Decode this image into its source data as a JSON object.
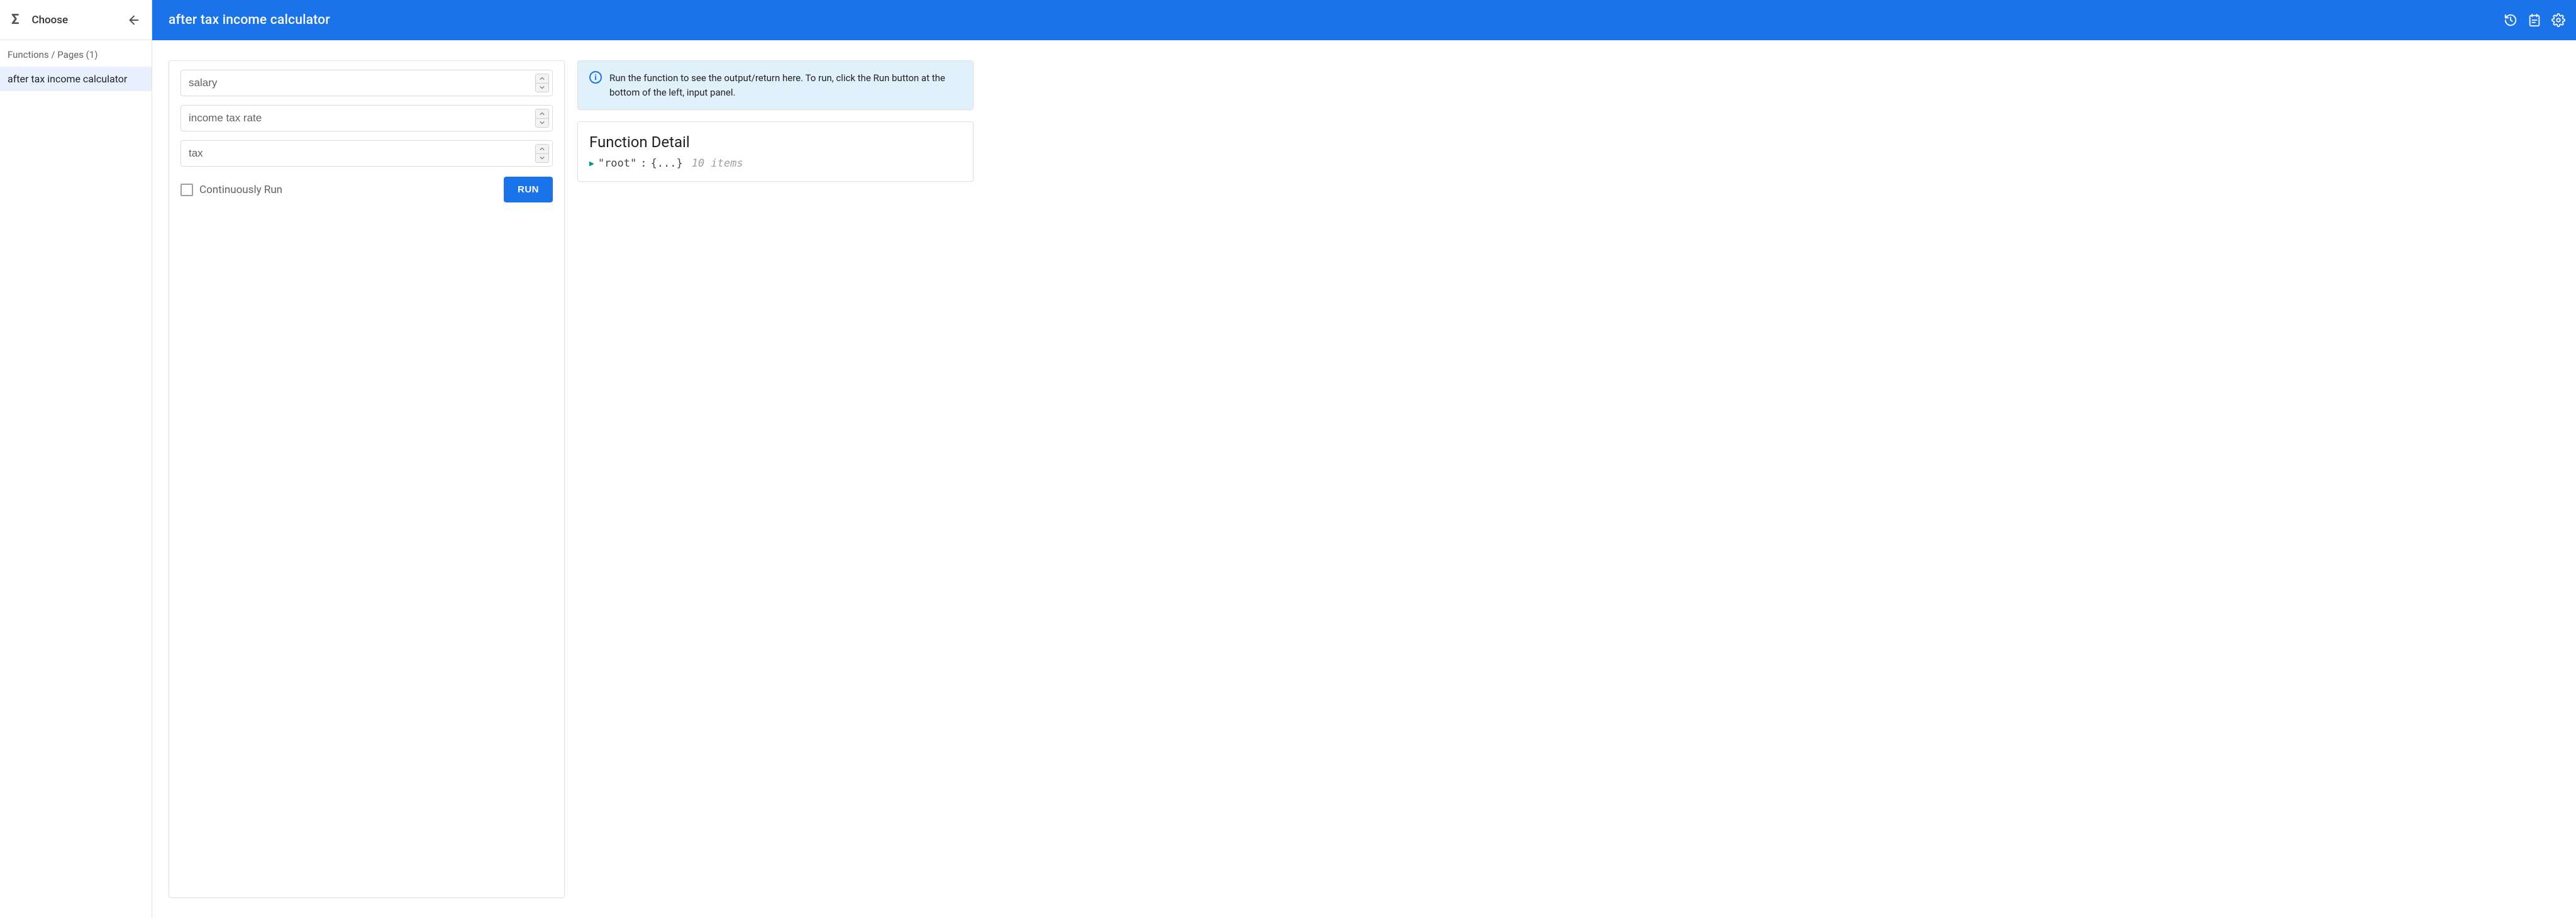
{
  "sidebar": {
    "choose_label": "Choose",
    "section_header": "Functions / Pages (1)",
    "items": [
      {
        "label": "after tax income calculator",
        "selected": true
      }
    ]
  },
  "topbar": {
    "title": "after tax income calculator"
  },
  "inputs": {
    "fields": [
      {
        "placeholder": "salary",
        "value": ""
      },
      {
        "placeholder": "income tax rate",
        "value": ""
      },
      {
        "placeholder": "tax",
        "value": ""
      }
    ],
    "continuously_run_label": "Continuously Run",
    "continuously_run_checked": false,
    "run_label": "RUN"
  },
  "output": {
    "info_text": "Run the function to see the output/return here. To run, click the Run button at the bottom of the left, input panel."
  },
  "detail": {
    "title": "Function Detail",
    "root_key": "\"root\"",
    "root_body": "{...}",
    "items_meta": "10 items"
  }
}
